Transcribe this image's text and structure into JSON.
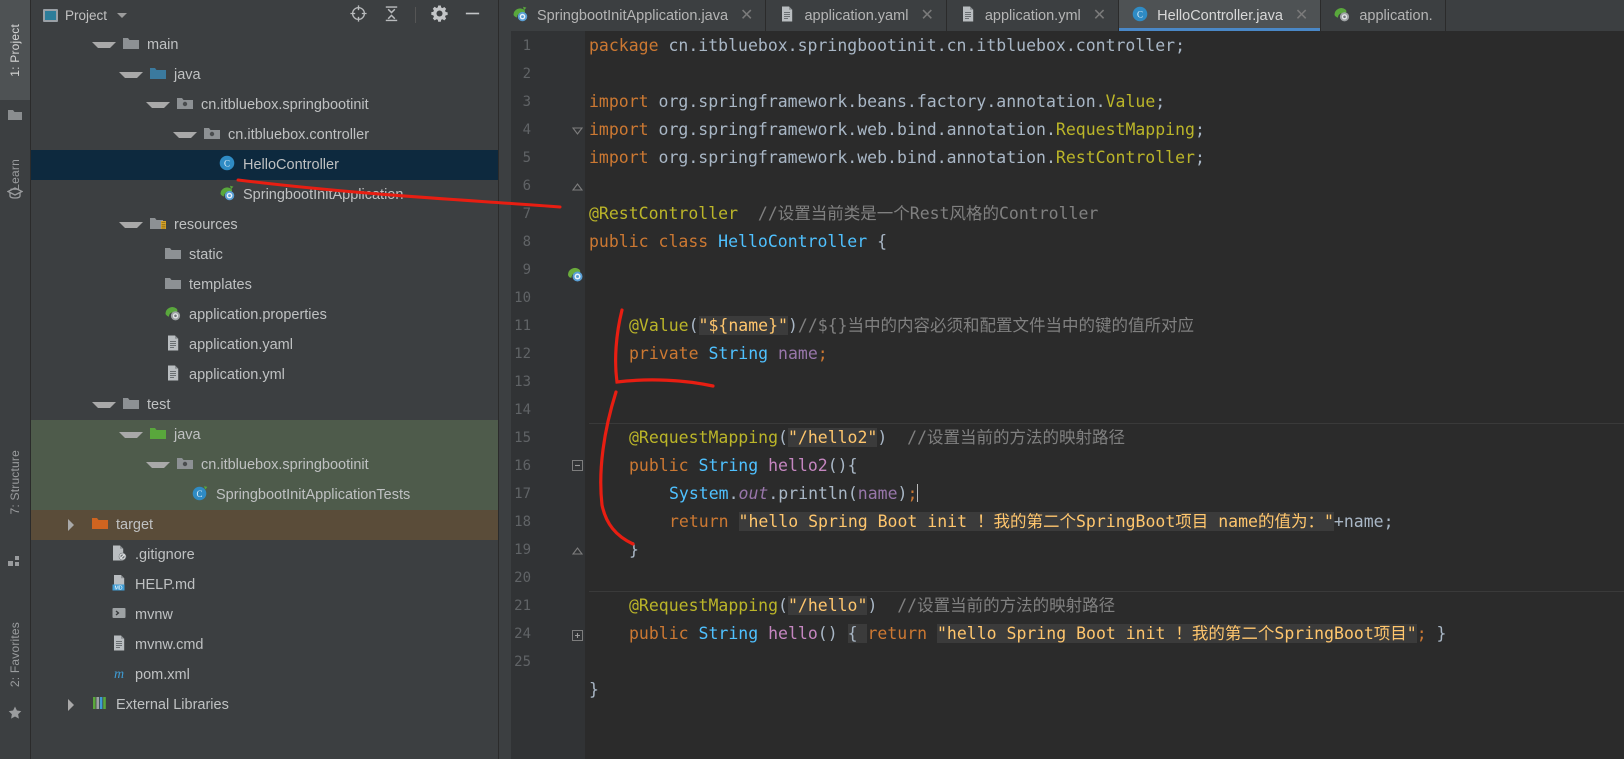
{
  "toolstrip": {
    "items": [
      {
        "label": "1: Project",
        "icon": "project-icon",
        "active": true
      },
      {
        "label": "Learn",
        "icon": "learn-icon",
        "active": false
      },
      {
        "label": "7: Structure",
        "icon": "structure-icon",
        "active": false
      },
      {
        "label": "2: Favorites",
        "icon": "star-icon",
        "active": false
      }
    ]
  },
  "project_panel": {
    "title": "Project",
    "icons": [
      "locate-icon",
      "collapse-all-icon",
      "gear-icon",
      "minimize-icon"
    ],
    "tree": [
      {
        "label": "main",
        "indent": 1,
        "arrow": "down",
        "icon": "folder-gray",
        "state": "normal"
      },
      {
        "label": "java",
        "indent": 2,
        "arrow": "down",
        "icon": "folder-blue",
        "state": "normal"
      },
      {
        "label": "cn.itbluebox.springbootinit",
        "indent": 3,
        "arrow": "down",
        "icon": "package-gray",
        "state": "normal"
      },
      {
        "label": "cn.itbluebox.controller",
        "indent": 4,
        "arrow": "down",
        "icon": "package-gray",
        "state": "normal"
      },
      {
        "label": "HelloController",
        "indent": 5,
        "arrow": "none",
        "icon": "class-icon",
        "state": "selected"
      },
      {
        "label": "SpringbootInitApplication",
        "indent": 5,
        "arrow": "none",
        "icon": "spring-class",
        "state": "normal"
      },
      {
        "label": "resources",
        "indent": 2,
        "arrow": "down",
        "icon": "folder-res",
        "state": "normal"
      },
      {
        "label": "static",
        "indent": 3,
        "arrow": "none",
        "icon": "folder-gray",
        "state": "normal"
      },
      {
        "label": "templates",
        "indent": 3,
        "arrow": "none",
        "icon": "folder-gray",
        "state": "normal"
      },
      {
        "label": "application.properties",
        "indent": 3,
        "arrow": "none",
        "icon": "spring-leaf",
        "state": "normal"
      },
      {
        "label": "application.yaml",
        "indent": 3,
        "arrow": "none",
        "icon": "file-doc",
        "state": "normal"
      },
      {
        "label": "application.yml",
        "indent": 3,
        "arrow": "none",
        "icon": "file-doc",
        "state": "normal"
      },
      {
        "label": "test",
        "indent": 1,
        "arrow": "down",
        "icon": "folder-gray",
        "state": "normal"
      },
      {
        "label": "java",
        "indent": 2,
        "arrow": "down",
        "icon": "folder-green",
        "state": "group-green"
      },
      {
        "label": "cn.itbluebox.springbootinit",
        "indent": 3,
        "arrow": "down",
        "icon": "package-gray",
        "state": "group-green"
      },
      {
        "label": "SpringbootInitApplicationTests",
        "indent": 4,
        "arrow": "none",
        "icon": "test-class",
        "state": "group-green"
      },
      {
        "label": "target",
        "indent": 0,
        "arrow": "right",
        "icon": "folder-orange",
        "state": "group-brown"
      },
      {
        "label": ".gitignore",
        "indent": 1,
        "arrow": "none",
        "icon": "gitignore-icon",
        "state": "normal"
      },
      {
        "label": "HELP.md",
        "indent": 1,
        "arrow": "none",
        "icon": "md-icon",
        "state": "normal"
      },
      {
        "label": "mvnw",
        "indent": 1,
        "arrow": "none",
        "icon": "shell-icon",
        "state": "normal"
      },
      {
        "label": "mvnw.cmd",
        "indent": 1,
        "arrow": "none",
        "icon": "file-doc",
        "state": "normal"
      },
      {
        "label": "pom.xml",
        "indent": 1,
        "arrow": "none",
        "icon": "maven-icon",
        "state": "normal"
      },
      {
        "label": "External Libraries",
        "indent": 0,
        "arrow": "right",
        "icon": "library-icon",
        "state": "normal"
      }
    ]
  },
  "editor": {
    "tabs": [
      {
        "label": "SpringbootInitApplication.java",
        "icon": "spring-class",
        "active": false,
        "closable": true
      },
      {
        "label": "application.yaml",
        "icon": "file-doc",
        "active": false,
        "closable": true
      },
      {
        "label": "application.yml",
        "icon": "file-doc",
        "active": false,
        "closable": true
      },
      {
        "label": "HelloController.java",
        "icon": "class-icon",
        "active": true,
        "closable": true
      },
      {
        "label": "application.",
        "icon": "spring-leaf",
        "active": false,
        "closable": false
      }
    ],
    "line_numbers": [
      "1",
      "2",
      "3",
      "4",
      "5",
      "6",
      "7",
      "8",
      "9",
      "10",
      "11",
      "12",
      "13",
      "14",
      "15",
      "16",
      "17",
      "18",
      "19",
      "20",
      "21",
      "24",
      "25"
    ],
    "code": {
      "l1_kw": "package",
      "l1_pkg": " cn.itbluebox.springbootinit.cn.itbluebox.controller;",
      "l3_kw": "import",
      "l3_pkg": " org.springframework.beans.factory.annotation.",
      "l3_cls": "Value",
      "l4_kw": "import",
      "l4_pkg": " org.springframework.web.bind.annotation.",
      "l4_cls": "RequestMapping",
      "l5_kw": "import",
      "l5_pkg": " org.springframework.web.bind.annotation.",
      "l5_cls": "RestController",
      "l7_anno": "@RestController",
      "l7_cmt": "//设置当前类是一个Rest风格的Controller",
      "l8_kw": "public class",
      "l8_cls": "HelloController",
      "l8_brace": "{",
      "l11_anno": "@Value",
      "l11_str": "\"${name}\"",
      "l11_cmt": "//${}当中的内容必须和配置文件当中的键的值所对应",
      "l12_kw": "private",
      "l12_cls": "String",
      "l12_field": "name",
      "l14_anno": "@RequestMapping",
      "l14_str": "\"/hello2\"",
      "l14_cmt": "//设置当前的方法的映射路径",
      "l15_kw": "public",
      "l15_cls": "String",
      "l15_meth": "hello2",
      "l16_sys": "System",
      "l16_out": "out",
      "l16_println": "println",
      "l16_arg": "name",
      "l17_kw": "return",
      "l17_str": "\"hello Spring Boot init ！我的第二个SpringBoot项目 name的值为：\"",
      "l17_concat": "+name;",
      "l18_brace": "}",
      "l20_anno": "@RequestMapping",
      "l20_str": "\"/hello\"",
      "l20_cmt": "//设置当前的方法的映射路径",
      "l21_kw": "public",
      "l21_cls": "String",
      "l21_meth": "hello",
      "l21_return": "return",
      "l21_str": "\"hello Spring Boot init ！我的第二个SpringBoot项目\"",
      "l25_brace": "}"
    }
  },
  "colors": {
    "accent": "#4a88c7",
    "selection": "#0d293e",
    "annotation_red": "#e81e12",
    "keyword": "#cc7832",
    "string": "#ffc66d",
    "comment": "#808080",
    "class": "#4fc1ff",
    "annotation_yellow": "#bbb529"
  }
}
